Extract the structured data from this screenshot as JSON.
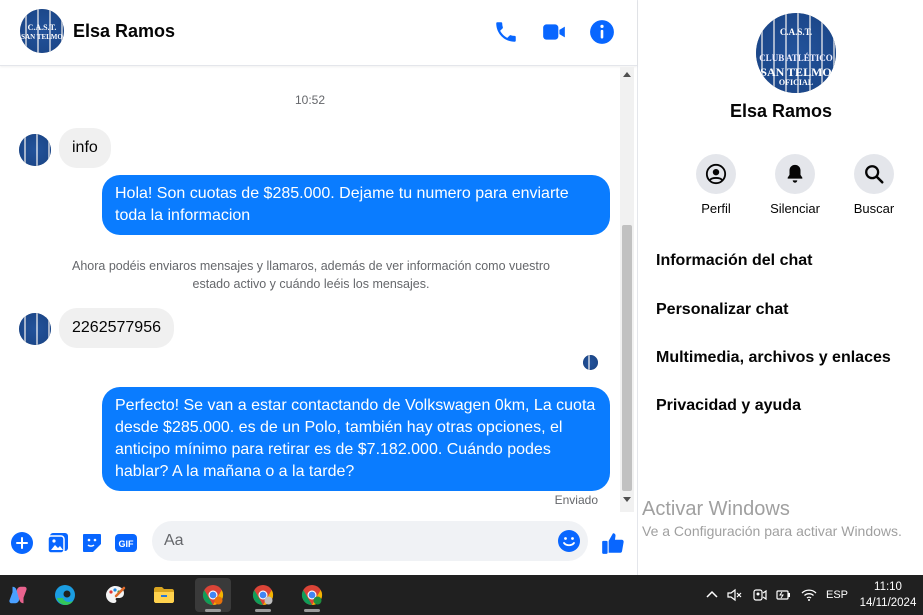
{
  "contact": {
    "name": "Elsa Ramos",
    "avatar_text": "C.A.S.T. CLUB ATLÉTICO SAN TELMO OFICIAL"
  },
  "header": {
    "icons": [
      "phone-icon",
      "video-camera-icon",
      "info-icon"
    ]
  },
  "messages": {
    "timestamp": "10:52",
    "in_1": "info",
    "out_1": "Hola! Son cuotas de $285.000. Dejame tu numero para enviarte toda la informacion",
    "notice": "Ahora podéis enviaros mensajes y llamaros, además de ver información como vuestro estado activo y cuándo leéis los mensajes.",
    "in_2": "2262577956",
    "out_2": "Perfecto!  Se van a estar contactando de Volkswagen 0km, La cuota desde $285.000. es de un Polo, también hay otras opciones, el anticipo mínimo para retirar es de $7.182.000. Cuándo podes hablar? A la mañana o a la tarde?",
    "status": "Enviado"
  },
  "composer": {
    "placeholder": "Aa"
  },
  "side_panel": {
    "name": "Elsa Ramos",
    "actions": [
      {
        "label": "Perfil",
        "icon": "profile-icon"
      },
      {
        "label": "Silenciar",
        "icon": "bell-icon"
      },
      {
        "label": "Buscar",
        "icon": "search-icon"
      }
    ],
    "menu": [
      "Información del chat",
      "Personalizar chat",
      "Multimedia, archivos y enlaces",
      "Privacidad y ayuda"
    ]
  },
  "watermark": {
    "line1": "Activar Windows",
    "line2": "Ve a Configuración para activar Windows."
  },
  "taskbar": {
    "language": "ESP",
    "time": "11:10",
    "date": "14/11/2024"
  },
  "colors": {
    "accent": "#0a7cff",
    "icon_blue": "#0866ff",
    "incoming_bubble": "#f0f0f0"
  }
}
